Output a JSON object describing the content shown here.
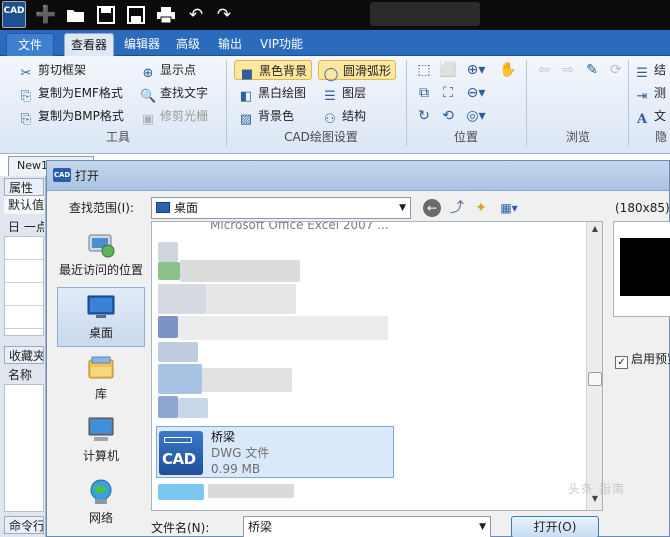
{
  "quick_access": {
    "logo_text": "CAD",
    "icons": [
      "new-icon",
      "open-folder-icon",
      "save-icon",
      "save-as-icon",
      "print-icon",
      "undo-icon",
      "redo-icon"
    ]
  },
  "ribbon": {
    "tabs": [
      "文件",
      "查看器",
      "编辑器",
      "高级",
      "输出",
      "VIP功能"
    ],
    "tools_group": {
      "items": [
        "剪切框架",
        "复制为EMF格式",
        "复制为BMP格式",
        "显示点",
        "查找文字",
        "修剪光栅"
      ],
      "label": "工具"
    },
    "cad_settings_group": {
      "items": [
        "黑色背景",
        "黑白绘图",
        "背景色",
        "圆滑弧形",
        "图层",
        "结构"
      ],
      "label": "CAD绘图设置"
    },
    "position_group": {
      "label": "位置"
    },
    "browse_group": {
      "label": "浏览"
    },
    "partial_right": {
      "item1": "结",
      "item2": "测",
      "item3": "文",
      "label": "隐"
    }
  },
  "document": {
    "tab_label": "New1",
    "left_pane": {
      "properties_header": "属性",
      "default_row": "默认值",
      "minus_row": "日 一点",
      "favorites_header": "收藏夹",
      "name_row": "名称",
      "command_header": "命令行"
    }
  },
  "dialog": {
    "title": "打开",
    "icon_text": "CAD",
    "look_in_label": "查找范围(I):",
    "look_in_value": "桌面",
    "preview_size": "(180x85)",
    "places": [
      "最近访问的位置",
      "桌面",
      "库",
      "计算机",
      "网络"
    ],
    "list_top_text": "Microsoft Office Excel 2007 ...",
    "selected_file": {
      "name": "桥梁",
      "type": "DWG 文件",
      "size": "0.99 MB",
      "thumb_text": "CAD"
    },
    "enable_preview_label": "启用预览",
    "enable_preview_checked": true,
    "filename_label": "文件名(N):",
    "filename_value": "桥梁",
    "open_button": "打开(O)"
  },
  "watermark": "头条 指南",
  "colors": {
    "ribbon_blue": "#2b6bbb",
    "selection_blue": "#d9e8fb",
    "highlight_orange": "#ffe7a0"
  }
}
